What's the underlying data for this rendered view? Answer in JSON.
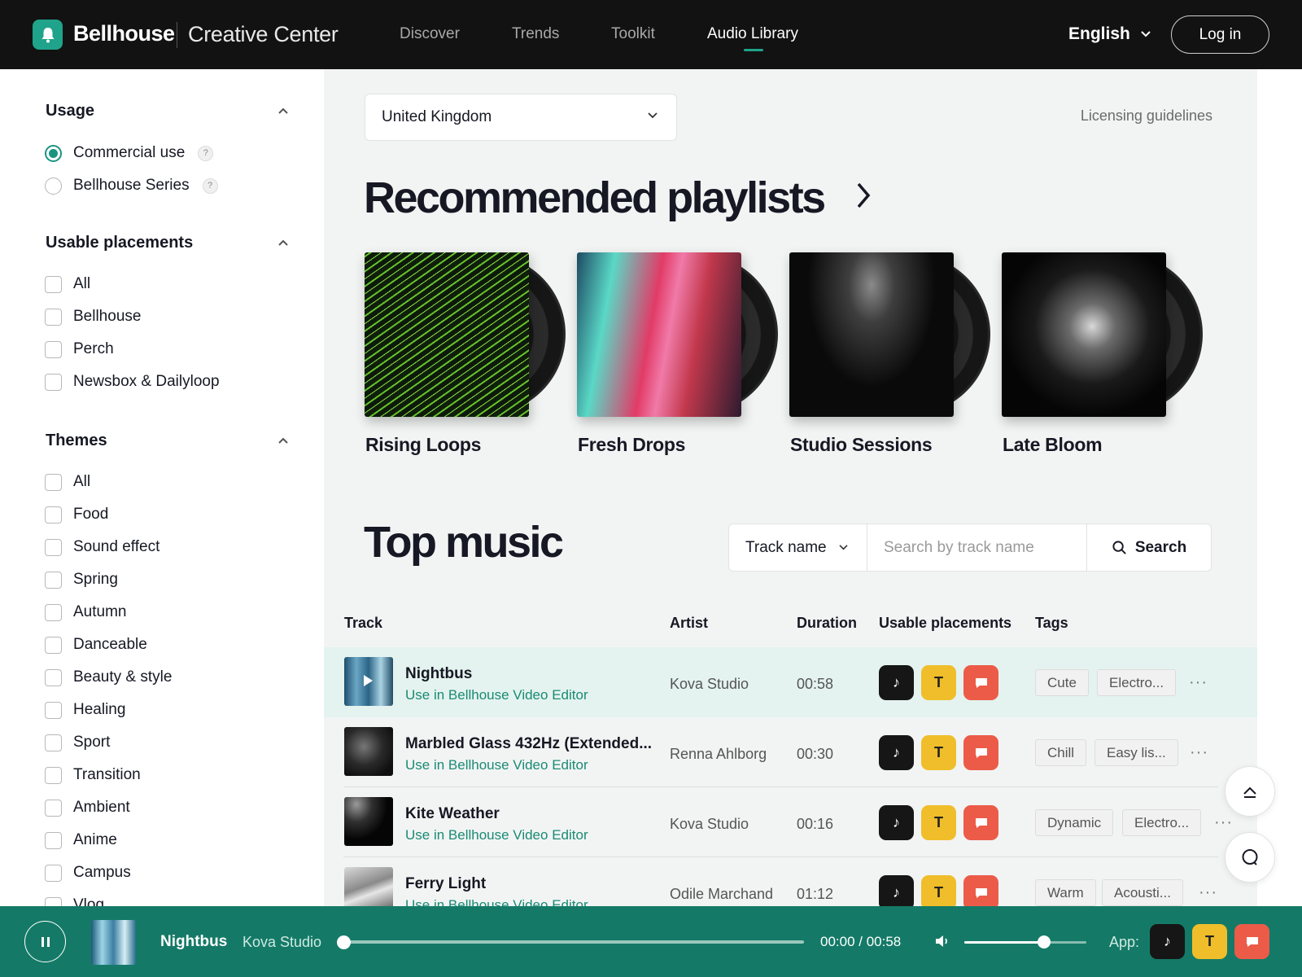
{
  "header": {
    "brand": "Bellhouse",
    "brand_sub": "Creative Center",
    "nav": [
      "Discover",
      "Trends",
      "Toolkit",
      "Audio Library"
    ],
    "active_nav": "Audio Library",
    "language": "English",
    "login": "Log in"
  },
  "sidebar": {
    "usage": {
      "title": "Usage",
      "options": [
        "Commercial use",
        "Bellhouse Series"
      ],
      "selected": "Commercial use",
      "help": "?"
    },
    "placements": {
      "title": "Usable placements",
      "options": [
        "All",
        "Bellhouse",
        "Perch",
        "Newsbox & Dailyloop"
      ]
    },
    "themes": {
      "title": "Themes",
      "options": [
        "All",
        "Food",
        "Sound effect",
        "Spring",
        "Autumn",
        "Danceable",
        "Beauty & style",
        "Healing",
        "Sport",
        "Transition",
        "Ambient",
        "Anime",
        "Campus",
        "Vlog"
      ]
    }
  },
  "main": {
    "region": "United Kingdom",
    "licensing_link": "Licensing guidelines",
    "recommended_title": "Recommended playlists",
    "playlists": [
      "Rising Loops",
      "Fresh Drops",
      "Studio Sessions",
      "Late Bloom"
    ],
    "top_music_title": "Top music",
    "search": {
      "field": "Track name",
      "placeholder": "Search by track name",
      "button": "Search"
    },
    "columns": {
      "track": "Track",
      "artist": "Artist",
      "duration": "Duration",
      "placements": "Usable placements",
      "tags": "Tags"
    },
    "editor_link": "Use in Bellhouse Video Editor",
    "tracks": [
      {
        "name": "Nightbus",
        "artist": "Kova Studio",
        "duration": "00:58",
        "tags": [
          "Cute",
          "Electro..."
        ]
      },
      {
        "name": "Marbled Glass 432Hz (Extended...",
        "artist": "Renna Ahlborg",
        "duration": "00:30",
        "tags": [
          "Chill",
          "Easy lis..."
        ]
      },
      {
        "name": "Kite Weather",
        "artist": "Kova Studio",
        "duration": "00:16",
        "tags": [
          "Dynamic",
          "Electro..."
        ]
      },
      {
        "name": "Ferry Light",
        "artist": "Odile Marchand",
        "duration": "01:12",
        "tags": [
          "Warm",
          "Acousti..."
        ]
      }
    ],
    "app_icons": {
      "t_label": "T"
    },
    "more": "···"
  },
  "player": {
    "title": "Nightbus",
    "artist": "Kova Studio",
    "time": "00:00 / 00:58",
    "progress": 0,
    "volume": 0.65,
    "app_label": "App:",
    "t_label": "T"
  },
  "colors": {
    "accent": "#1fa38a",
    "player_bg": "#147a67",
    "app_black": "#161616",
    "app_yellow": "#f0be2a",
    "app_red": "#ec5b48"
  }
}
